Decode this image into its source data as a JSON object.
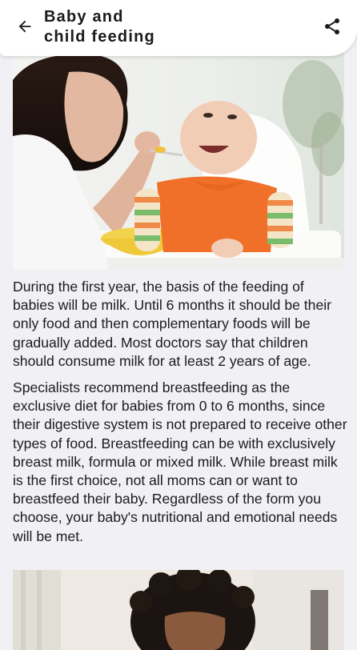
{
  "header": {
    "title_line1": "Baby and",
    "title_line2": "child feeding",
    "back_icon": "arrow-left-icon",
    "share_icon": "share-icon"
  },
  "article": {
    "paragraphs": [
      "During the first year, the basis of the feeding of babies will be milk. Until 6 months it should be their only food and then complementary foods will be gradually added. Most doctors say that children should consume milk for at least 2 years of age.",
      "Specialists recommend breastfeeding as the exclusive diet for babies from 0 to 6 months, since their digestive system is not prepared to receive other types of food. Breastfeeding can be with exclusively breast milk, formula or mixed milk. While breast milk is the first choice, not all moms can or want to breastfeed their baby. Regardless of the form you choose, your baby's nutritional and emotional needs will be met."
    ]
  },
  "colors": {
    "background": "#f1f0f5",
    "app_bar": "#ffffff",
    "bib": "#f0702a",
    "text": "#1b1b1b"
  }
}
